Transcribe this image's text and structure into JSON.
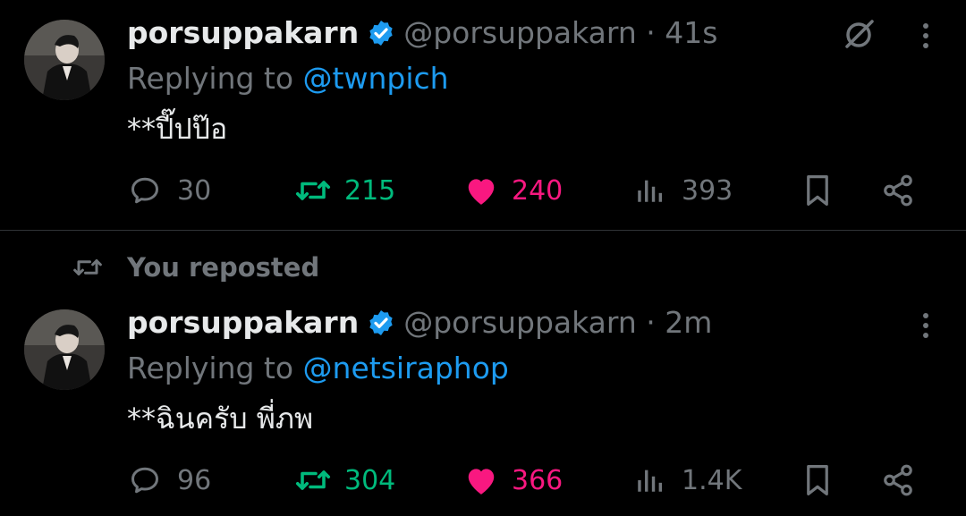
{
  "colors": {
    "background": "#000000",
    "text": "#e7e9ea",
    "muted": "#71767b",
    "link": "#1d9bf0",
    "verified": "#1d9bf0",
    "repost": "#00ba7c",
    "like": "#f91880",
    "divider": "#2f3336"
  },
  "posts": [
    {
      "name": "porsuppakarn",
      "handle_time": "@porsuppakarn · 41s",
      "replying_prefix": "Replying to ",
      "replying_to": "@twnpich",
      "text": "**ปี๊ปป๊อ",
      "top_icon": "grok-slash-icon",
      "replies": "30",
      "reposts": "215",
      "likes": "240",
      "views": "393",
      "reposted_state": true,
      "liked_state": true
    },
    {
      "name": "porsuppakarn",
      "handle_time": "@porsuppakarn · 2m",
      "replying_prefix": "Replying to ",
      "replying_to": "@netsiraphop",
      "text": "**ฉินครับ พี่ภพ",
      "replies": "96",
      "reposts": "304",
      "likes": "366",
      "views": "1.4K",
      "reposted_state": true,
      "liked_state": true
    }
  ],
  "repost_banner": "You reposted"
}
